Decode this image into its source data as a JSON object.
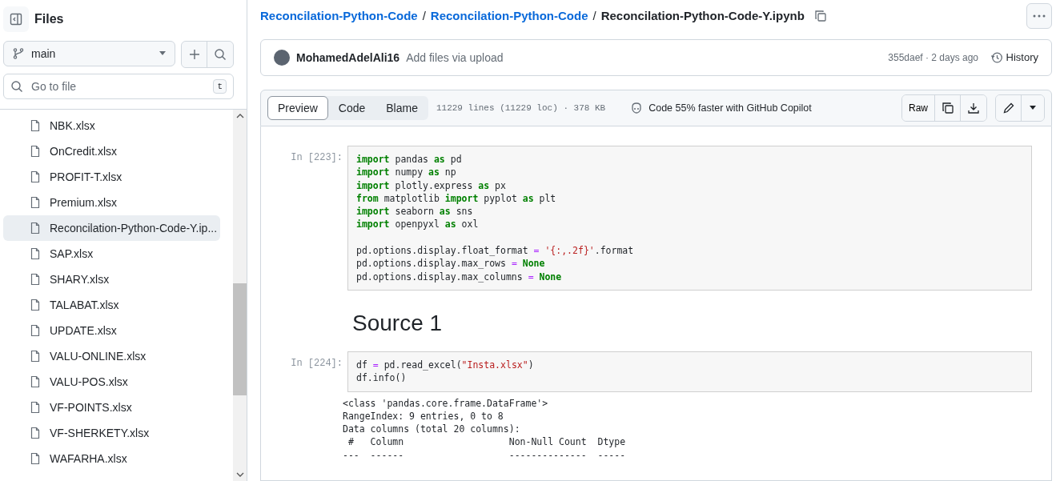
{
  "sidebar": {
    "title": "Files",
    "branch": "main",
    "search": {
      "placeholder": "Go to file",
      "shortcut": "t"
    },
    "files": [
      {
        "name": "NBK.xlsx",
        "selected": false
      },
      {
        "name": "OnCredit.xlsx",
        "selected": false
      },
      {
        "name": "PROFIT-T.xlsx",
        "selected": false
      },
      {
        "name": "Premium.xlsx",
        "selected": false
      },
      {
        "name": "Reconcilation-Python-Code-Y.ip...",
        "selected": true
      },
      {
        "name": "SAP.xlsx",
        "selected": false
      },
      {
        "name": "SHARY.xlsx",
        "selected": false
      },
      {
        "name": "TALABAT.xlsx",
        "selected": false
      },
      {
        "name": "UPDATE.xlsx",
        "selected": false
      },
      {
        "name": "VALU-ONLINE.xlsx",
        "selected": false
      },
      {
        "name": "VALU-POS.xlsx",
        "selected": false
      },
      {
        "name": "VF-POINTS.xlsx",
        "selected": false
      },
      {
        "name": "VF-SHERKETY.xlsx",
        "selected": false
      },
      {
        "name": "WAFARHA.xlsx",
        "selected": false
      }
    ]
  },
  "breadcrumb": {
    "parts": [
      "Reconcilation-Python-Code",
      "Reconcilation-Python-Code"
    ],
    "separator": "/",
    "current": "Reconcilation-Python-Code-Y.ipynb"
  },
  "commit": {
    "author": "MohamedAdelAli16",
    "message": "Add files via upload",
    "meta": "355daef · 2 days ago",
    "history": "History"
  },
  "file_header": {
    "tabs": [
      {
        "label": "Preview",
        "selected": true
      },
      {
        "label": "Code",
        "selected": false
      },
      {
        "label": "Blame",
        "selected": false
      }
    ],
    "info": "11229 lines (11229 loc) · 378 KB",
    "copilot": "Code 55% faster with GitHub Copilot",
    "raw": "Raw"
  },
  "cells": [
    {
      "kind": "code",
      "prompt": "In [223]:",
      "groups": [
        [
          [
            {
              "text": "import",
              "kind": "keyword"
            },
            {
              "text": " pandas ",
              "kind": "plain"
            },
            {
              "text": "as",
              "kind": "keyword"
            },
            {
              "text": " pd",
              "kind": "plain"
            }
          ],
          [
            {
              "text": "import",
              "kind": "keyword"
            },
            {
              "text": " numpy ",
              "kind": "plain"
            },
            {
              "text": "as",
              "kind": "keyword"
            },
            {
              "text": " np",
              "kind": "plain"
            }
          ],
          [
            {
              "text": "import",
              "kind": "keyword"
            },
            {
              "text": " plotly.express ",
              "kind": "plain"
            },
            {
              "text": "as",
              "kind": "keyword"
            },
            {
              "text": " px",
              "kind": "plain"
            }
          ],
          [
            {
              "text": "from",
              "kind": "keyword"
            },
            {
              "text": " matplotlib ",
              "kind": "plain"
            },
            {
              "text": "import",
              "kind": "keyword"
            },
            {
              "text": " pyplot ",
              "kind": "plain"
            },
            {
              "text": "as",
              "kind": "keyword"
            },
            {
              "text": " plt",
              "kind": "plain"
            }
          ],
          [
            {
              "text": "import",
              "kind": "keyword"
            },
            {
              "text": " seaborn ",
              "kind": "plain"
            },
            {
              "text": "as",
              "kind": "keyword"
            },
            {
              "text": " sns",
              "kind": "plain"
            }
          ],
          [
            {
              "text": "import",
              "kind": "keyword"
            },
            {
              "text": " openpyxl ",
              "kind": "plain"
            },
            {
              "text": "as",
              "kind": "keyword"
            },
            {
              "text": " oxl",
              "kind": "plain"
            }
          ]
        ],
        [
          [
            {
              "text": "pd.options.display.float_format ",
              "kind": "plain"
            },
            {
              "text": "=",
              "kind": "operator"
            },
            {
              "text": " '{:,.2f}'",
              "kind": "string"
            },
            {
              "text": ".format",
              "kind": "plain"
            }
          ],
          [
            {
              "text": "pd.options.display.max_rows ",
              "kind": "plain"
            },
            {
              "text": "=",
              "kind": "operator"
            },
            {
              "text": " None",
              "kind": "keyword"
            }
          ],
          [
            {
              "text": "pd.options.display.max_columns ",
              "kind": "plain"
            },
            {
              "text": "=",
              "kind": "operator"
            },
            {
              "text": " None",
              "kind": "keyword"
            }
          ]
        ]
      ]
    },
    {
      "kind": "markdown",
      "heading": "Source 1"
    },
    {
      "kind": "code",
      "prompt": "In [224]:",
      "groups": [
        [
          [
            {
              "text": "df ",
              "kind": "plain"
            },
            {
              "text": "=",
              "kind": "operator"
            },
            {
              "text": " pd.read_excel(",
              "kind": "plain"
            },
            {
              "text": "\"Insta.xlsx\"",
              "kind": "string"
            },
            {
              "text": ")",
              "kind": "plain"
            }
          ],
          [
            {
              "text": "df.info()",
              "kind": "plain"
            }
          ]
        ]
      ],
      "output": [
        "<class 'pandas.core.frame.DataFrame'>",
        "RangeIndex: 9 entries, 0 to 8",
        "Data columns (total 20 columns):",
        " #   Column                   Non-Null Count  Dtype",
        "---  ------                   --------------  -----"
      ]
    }
  ]
}
